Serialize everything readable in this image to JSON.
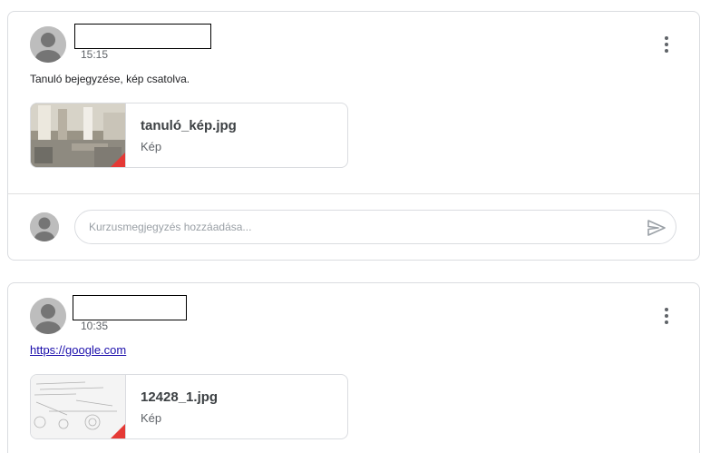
{
  "posts": [
    {
      "time": "15:15",
      "text": "Tanuló bejegyzése, kép csatolva.",
      "attachment": {
        "title": "tanuló_kép.jpg",
        "subtitle": "Kép"
      },
      "comment_placeholder": "Kurzusmegjegyzés hozzáadása..."
    },
    {
      "time": "10:35",
      "link": "https://google.com",
      "attachment": {
        "title": "12428_1.jpg",
        "subtitle": "Kép"
      }
    }
  ],
  "colors": {
    "card_border": "#dadce0",
    "link": "#1a0dab",
    "thumb_badge": "#e53935",
    "icon_gray": "#5f6368"
  },
  "icons": {
    "more": "more-vert-icon",
    "send": "send-icon",
    "avatar": "person-avatar"
  }
}
